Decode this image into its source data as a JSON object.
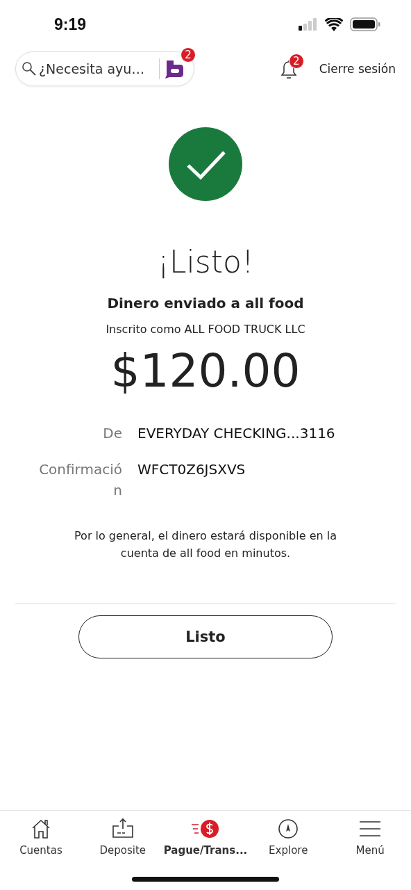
{
  "status_bar": {
    "time": "9:19"
  },
  "header": {
    "search": {
      "placeholder": "¿Necesita ayu…"
    },
    "assistant_badge": "2",
    "notifications_badge": "2",
    "logout": "Cierre sesión"
  },
  "confirmation": {
    "title": "¡Listo!",
    "subtitle": "Dinero enviado a all food",
    "enrolled_as": "Inscrito como ALL FOOD TRUCK LLC",
    "amount": "$120.00",
    "details": [
      {
        "label": "De",
        "value": "EVERYDAY CHECKING...3116"
      },
      {
        "label": "Confirmación",
        "value": "WFCT0Z6JSXVS"
      }
    ],
    "note": "Por lo general, el dinero estará disponible en la cuenta de all food en minutos.",
    "button": "Listo"
  },
  "tab_bar": [
    {
      "kind": "home",
      "label": "Cuentas",
      "selected": false
    },
    {
      "kind": "deposit",
      "label": "Deposite",
      "selected": false
    },
    {
      "kind": "pay",
      "label": "Pague/Trans...",
      "selected": true
    },
    {
      "kind": "explore",
      "label": "Explore",
      "selected": false
    },
    {
      "kind": "menu",
      "label": "Menú",
      "selected": false
    }
  ]
}
